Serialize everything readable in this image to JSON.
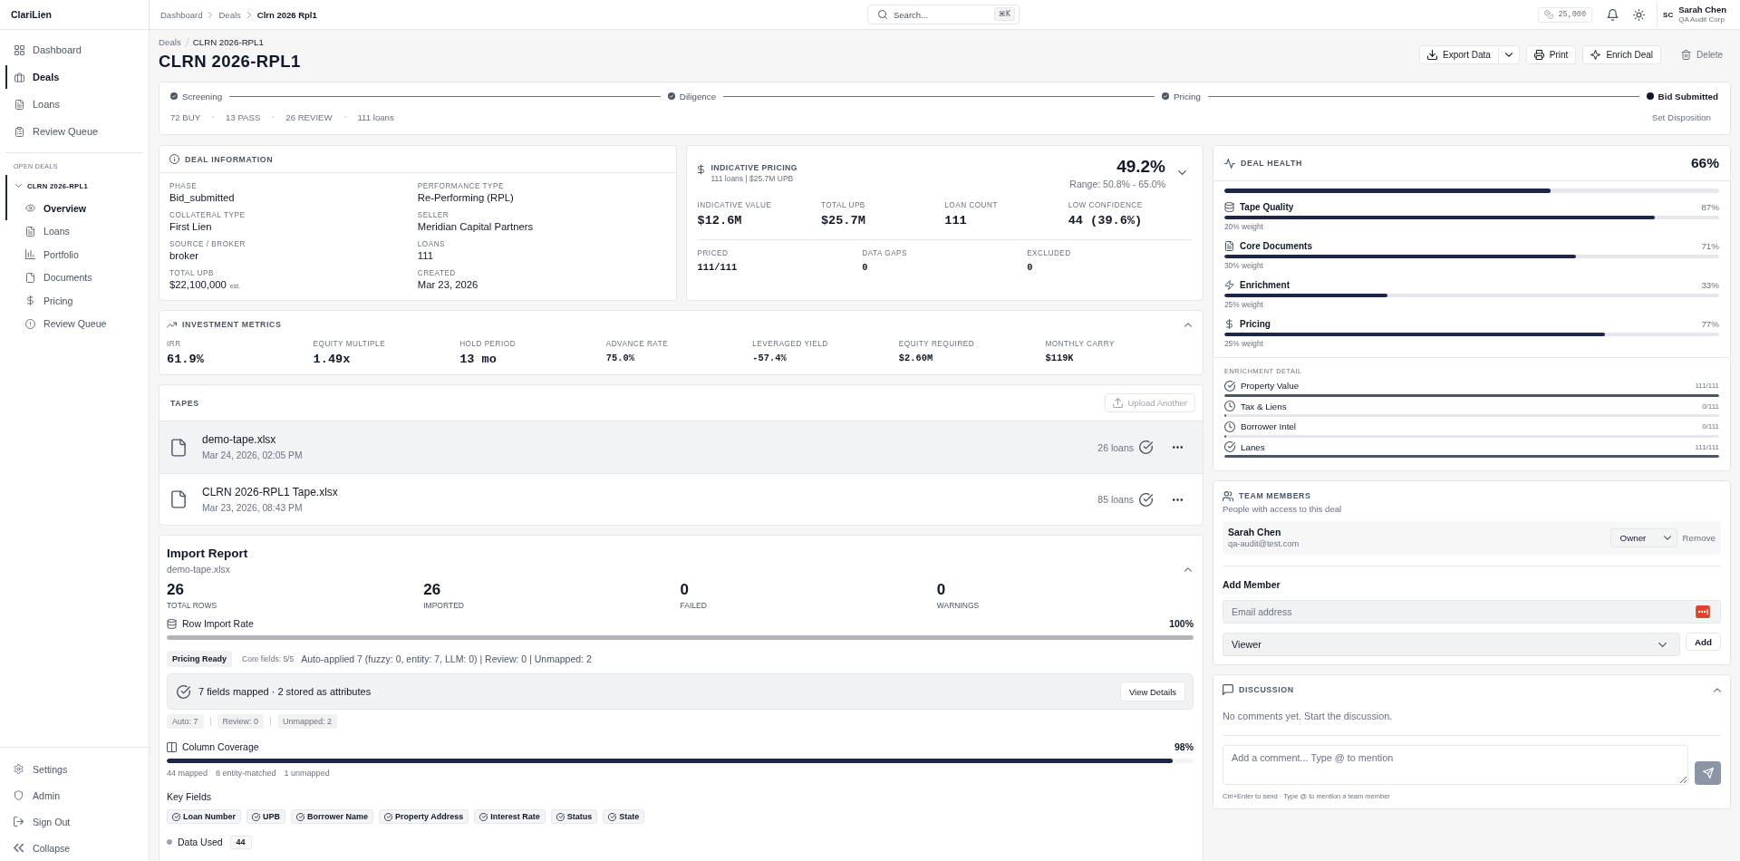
{
  "sidebar": {
    "logo": "ClariLien",
    "nav": [
      {
        "label": "Dashboard",
        "selected": false
      },
      {
        "label": "Deals",
        "selected": true
      },
      {
        "label": "Loans",
        "selected": false
      },
      {
        "label": "Review Queue",
        "selected": false
      }
    ],
    "open_deals": {
      "heading": "OPEN DEALS",
      "deals": [
        {
          "label": "CLRN 2026-RPL1",
          "selected": true,
          "expanded": true,
          "children": [
            {
              "label": "Overview",
              "selected": true
            },
            {
              "label": "Loans",
              "selected": false
            },
            {
              "label": "Portfolio",
              "selected": false
            },
            {
              "label": "Documents",
              "selected": false
            },
            {
              "label": "Pricing",
              "selected": false
            },
            {
              "label": "Review Queue",
              "selected": false
            }
          ]
        }
      ]
    },
    "footer": [
      {
        "label": "Settings"
      },
      {
        "label": "Admin"
      },
      {
        "label": "Sign Out"
      },
      {
        "label": "Collapse"
      }
    ]
  },
  "topbar": {
    "breadcrumb": [
      "Dashboard",
      "Deals",
      "Clrn 2026 Rpl1"
    ],
    "search": {
      "placeholder": "Search...",
      "shortcut": "⌘K"
    },
    "credits": "25,000",
    "user": {
      "initials": "SC",
      "name": "Sarah Chen",
      "org": "QA Audit Corp"
    }
  },
  "page_header": {
    "breadcrumb": [
      "Deals",
      "CLRN 2026-RPL1"
    ],
    "title": "CLRN 2026-RPL1",
    "actions": {
      "export": "Export Data",
      "print": "Print",
      "enrich": "Enrich Deal",
      "delete": "Delete"
    }
  },
  "stage_tracker": {
    "stages": [
      {
        "label": "Screening",
        "current": false
      },
      {
        "label": "Diligence",
        "current": false
      },
      {
        "label": "Pricing",
        "current": false
      },
      {
        "label": "Bid Submitted",
        "current": true
      }
    ],
    "stats": [
      "72 BUY",
      "13 PASS",
      "26 REVIEW",
      "111 loans"
    ],
    "action": "Set Disposition"
  },
  "deal_information": {
    "title": "DEAL INFORMATION",
    "fields": [
      {
        "label": "PHASE",
        "value": "Bid_submitted"
      },
      {
        "label": "PERFORMANCE TYPE",
        "value": "Re-Performing (RPL)"
      },
      {
        "label": "COLLATERAL TYPE",
        "value": "First Lien"
      },
      {
        "label": "SELLER",
        "value": "Meridian Capital Partners"
      },
      {
        "label": "SOURCE / BROKER",
        "value": "broker"
      },
      {
        "label": "LOANS",
        "value": "111"
      },
      {
        "label": "TOTAL UPB",
        "value": "$22,100,000",
        "note": "est."
      },
      {
        "label": "CREATED",
        "value": "Mar 23, 2026"
      }
    ]
  },
  "indicative_pricing": {
    "title": "INDICATIVE PRICING",
    "subtitle": "111 loans | $25.7M UPB",
    "value": "49.2%",
    "range": "Range: 50.8% - 65.0%",
    "metrics": [
      {
        "label": "INDICATIVE VALUE",
        "value": "$12.6M"
      },
      {
        "label": "TOTAL UPB",
        "value": "$25.7M"
      },
      {
        "label": "LOAN COUNT",
        "value": "111"
      },
      {
        "label": "LOW CONFIDENCE",
        "value": "44 (39.6%)"
      }
    ],
    "details": [
      {
        "label": "PRICED",
        "value": "111/111"
      },
      {
        "label": "DATA GAPS",
        "value": "0"
      },
      {
        "label": "EXCLUDED",
        "value": "0"
      }
    ]
  },
  "investment_metrics": {
    "title": "INVESTMENT METRICS",
    "expanded": true,
    "metrics": [
      {
        "label": "IRR",
        "value": "61.9%",
        "kind": "primary"
      },
      {
        "label": "EQUITY MULTIPLE",
        "value": "1.49x",
        "kind": "primary"
      },
      {
        "label": "HOLD PERIOD",
        "value": "13 mo",
        "kind": "primary"
      },
      {
        "label": "ADVANCE RATE",
        "value": "75.0%",
        "kind": "secondary"
      },
      {
        "label": "LEVERAGED YIELD",
        "value": "-57.4%",
        "kind": "secondary"
      },
      {
        "label": "EQUITY REQUIRED",
        "value": "$2.60M",
        "kind": "secondary"
      },
      {
        "label": "MONTHLY CARRY",
        "value": "$119K",
        "kind": "secondary"
      }
    ]
  },
  "tapes": {
    "title": "TAPES",
    "upload": "Upload Another",
    "rows": [
      {
        "name": "demo-tape.xlsx",
        "date": "Mar 24, 2026, 02:05 PM",
        "loans": "26 loans",
        "selected": true
      },
      {
        "name": "CLRN 2026-RPL1 Tape.xlsx",
        "date": "Mar 23, 2026, 08:43 PM",
        "loans": "85 loans",
        "selected": false
      }
    ]
  },
  "import_report": {
    "title": "Import Report",
    "file": "demo-tape.xlsx",
    "expanded": true,
    "stats": [
      {
        "value": "26",
        "label": "TOTAL ROWS"
      },
      {
        "value": "26",
        "label": "IMPORTED"
      },
      {
        "value": "0",
        "label": "FAILED"
      },
      {
        "value": "0",
        "label": "WARNINGS"
      }
    ],
    "row_import": {
      "label": "Row Import Rate",
      "value": "100%",
      "level": 1
    },
    "status_badge": "Pricing Ready",
    "core_fields": "Core fields: 5/5",
    "summary": "Auto-applied 7 (fuzzy: 0, entity: 7, LLM: 0) | Review: 0 | Unmapped: 2",
    "mapping": {
      "text": "7 fields mapped · 2 stored as attributes",
      "button": "View Details"
    },
    "counts": [
      "Auto: 7",
      "Review: 0",
      "Unmapped: 2"
    ],
    "column_coverage": {
      "label": "Column Coverage",
      "value": "98%",
      "level": 0.98,
      "notes": [
        "44 mapped",
        "8 entity-matched",
        "1 unmapped"
      ]
    },
    "key_fields": {
      "label": "Key Fields",
      "items": [
        "Loan Number",
        "UPB",
        "Borrower Name",
        "Property Address",
        "Interest Rate",
        "Status",
        "State"
      ]
    },
    "data_used": {
      "label": "Data Used",
      "count": "44"
    }
  },
  "deal_health": {
    "title": "DEAL HEALTH",
    "score": "66%",
    "level": 0.66,
    "factors": [
      {
        "label": "Tape Quality",
        "value": "87%",
        "level": 0.87,
        "weight": "20% weight"
      },
      {
        "label": "Core Documents",
        "value": "71%",
        "level": 0.71,
        "weight": "30% weight"
      },
      {
        "label": "Enrichment",
        "value": "33%",
        "level": 0.33,
        "weight": "25% weight"
      },
      {
        "label": "Pricing",
        "value": "77%",
        "level": 0.77,
        "weight": "25% weight"
      }
    ],
    "enrichment": {
      "title": "ENRICHMENT DETAIL",
      "items": [
        {
          "label": "Property Value",
          "count": "111/111",
          "level": 1,
          "complete": true
        },
        {
          "label": "Tax & Liens",
          "count": "0/111",
          "level": 0,
          "complete": false
        },
        {
          "label": "Borrower Intel",
          "count": "0/111",
          "level": 0,
          "complete": false
        },
        {
          "label": "Lanes",
          "count": "111/111",
          "level": 1,
          "complete": true
        }
      ]
    }
  },
  "team_members": {
    "title": "TEAM MEMBERS",
    "subtitle": "People with access to this deal",
    "members": [
      {
        "name": "Sarah Chen",
        "email": "qa-audit@test.com",
        "role": "Owner",
        "remove": "Remove"
      }
    ],
    "add_member": {
      "title": "Add Member",
      "email": {
        "placeholder": "Email address"
      },
      "role": "Viewer",
      "button": "Add"
    }
  },
  "discussion": {
    "title": "DISCUSSION",
    "expanded": true,
    "empty": "No comments yet. Start the discussion.",
    "comment": {
      "placeholder": "Add a comment... Type @ to mention"
    },
    "hint": "Ctrl+Enter to send · Type @ to mention a team member"
  }
}
